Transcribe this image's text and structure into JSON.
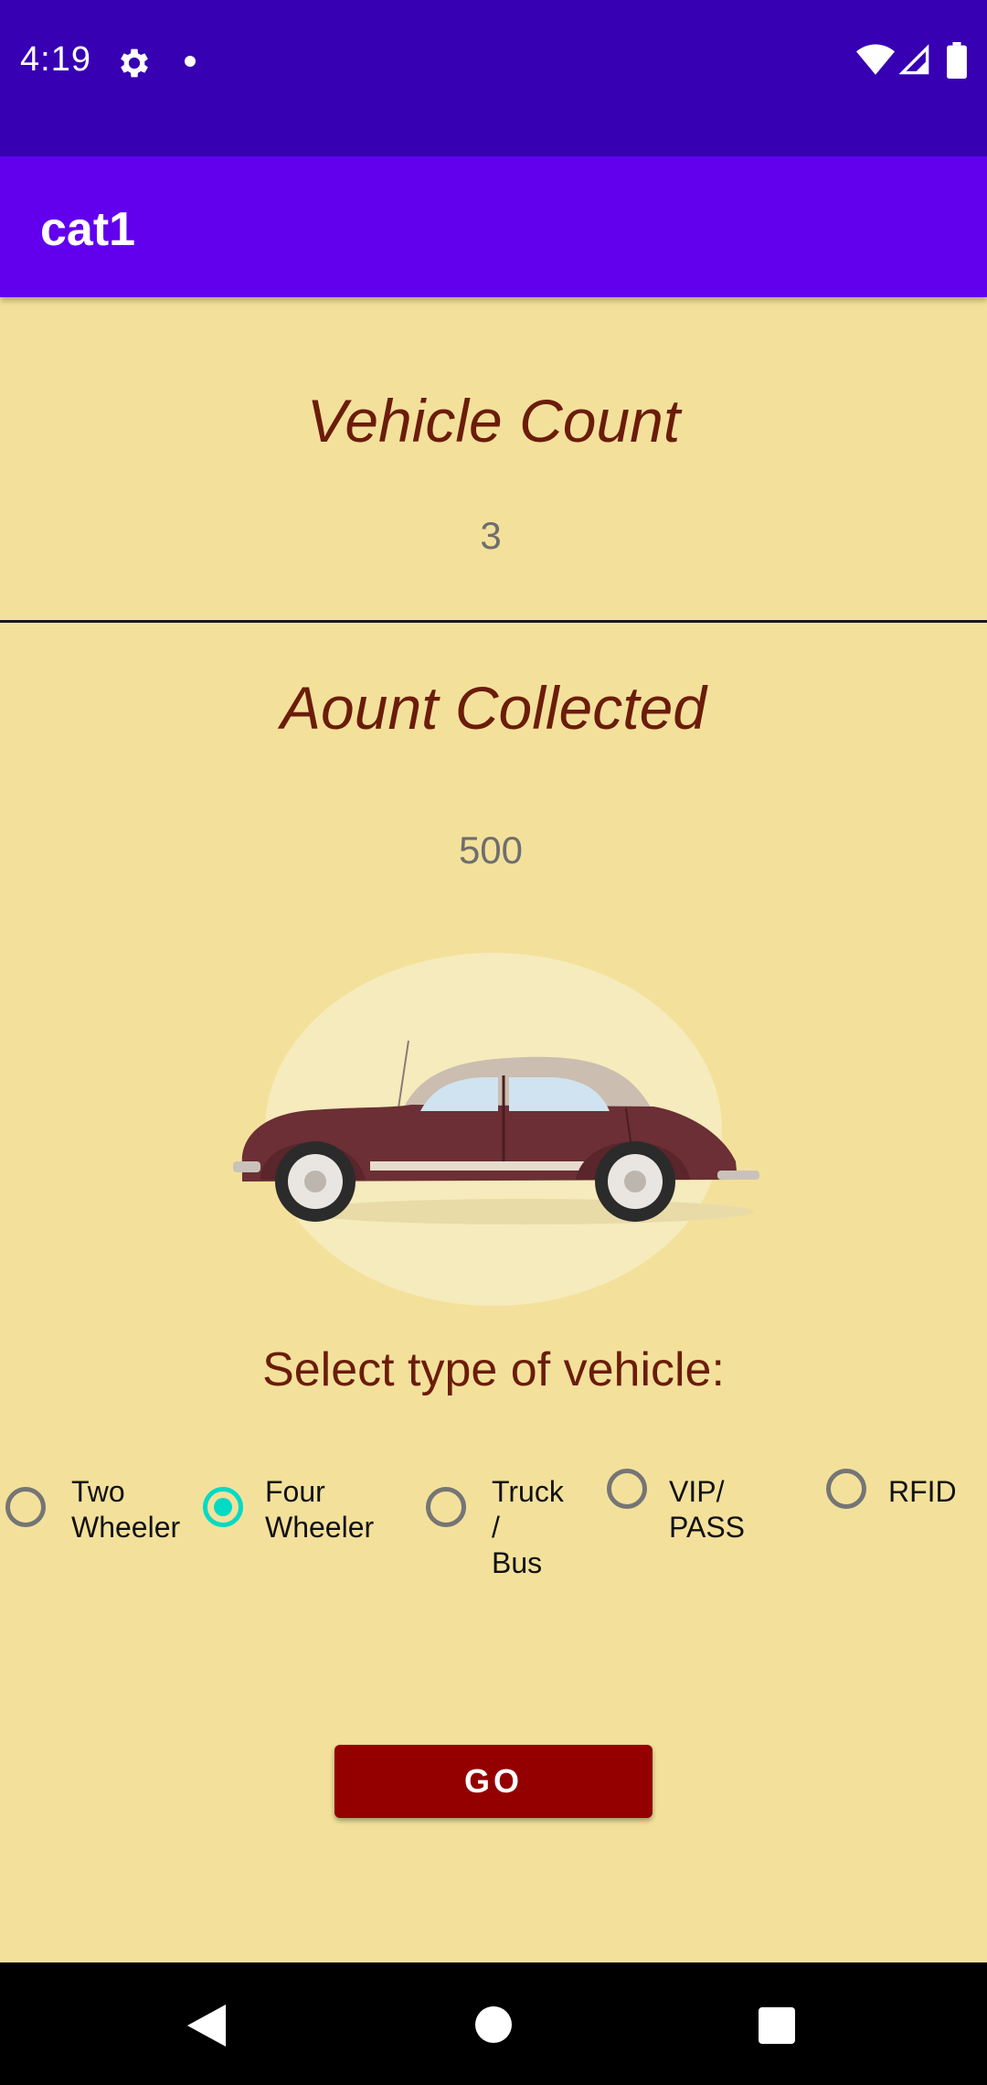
{
  "status_bar": {
    "time": "4:19",
    "icons": [
      "gear-icon",
      "notification-dot-icon",
      "wifi-icon",
      "signal-icon",
      "battery-icon"
    ]
  },
  "app_bar": {
    "title": "cat1"
  },
  "vehicle_count": {
    "heading": "Vehicle Count",
    "value": "3"
  },
  "amount_collected": {
    "heading": "Aount Collected",
    "value": "500"
  },
  "vehicle_selector": {
    "label": "Select type of vehicle:",
    "options": [
      {
        "label": "Two\nWheeler",
        "checked": false
      },
      {
        "label": "Four\nWheeler",
        "checked": true
      },
      {
        "label": "Truck /\nBus",
        "checked": false
      },
      {
        "label": "VIP/ PASS",
        "checked": false
      },
      {
        "label": "RFID",
        "checked": false
      }
    ],
    "selected": "Four Wheeler"
  },
  "go_button": {
    "label": "GO"
  },
  "colors": {
    "status_bar": "#3700b3",
    "app_bar": "#6200ee",
    "background": "#f3e19b",
    "heading_text": "#6b1c0a",
    "radio_checked": "#03dac5",
    "go_button": "#940000"
  },
  "nav_bar": {
    "icons": [
      "back-icon",
      "home-icon",
      "recents-icon"
    ]
  }
}
